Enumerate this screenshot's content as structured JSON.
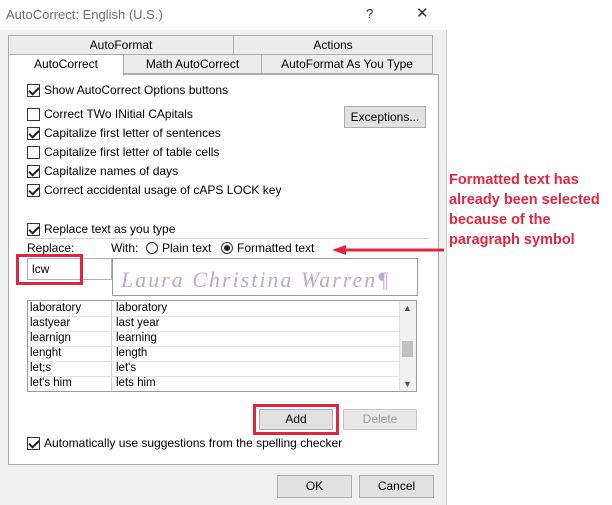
{
  "window": {
    "title": "AutoCorrect: English (U.S.)",
    "help": "?",
    "close": "✕"
  },
  "tabs": {
    "row1": [
      "AutoFormat",
      "Actions"
    ],
    "row2": [
      "AutoCorrect",
      "Math AutoCorrect",
      "AutoFormat As You Type"
    ]
  },
  "options": {
    "show_buttons": "Show AutoCorrect Options buttons",
    "two_initials": "Correct TWo INitial CApitals",
    "first_letter_sentences": "Capitalize first letter of sentences",
    "first_letter_cells": "Capitalize first letter of table cells",
    "names_of_days": "Capitalize names of days",
    "caps_lock": "Correct accidental usage of cAPS LOCK key",
    "exceptions_button": "Exceptions...",
    "replace_as_you_type": "Replace text as you type"
  },
  "replace": {
    "replace_label": "Replace:",
    "with_label": "With:",
    "plain_text": "Plain text",
    "formatted_text": "Formatted text",
    "selected_option": "Formatted text",
    "replace_value": "lcw",
    "with_value": "Laura Christina Warren¶"
  },
  "list": [
    [
      "laboratory",
      "laboratory"
    ],
    [
      "lastyear",
      "last year"
    ],
    [
      "learnign",
      "learning"
    ],
    [
      "lenght",
      "length"
    ],
    [
      "let;s",
      "let's"
    ],
    [
      "let's him",
      "lets him"
    ]
  ],
  "buttons": {
    "add": "Add",
    "delete": "Delete",
    "ok": "OK",
    "cancel": "Cancel"
  },
  "spelling_suggestions": "Automatically use suggestions from the spelling checker",
  "annotation": {
    "text": "Formatted text has already been selected because of the paragraph symbol",
    "color": "#e3263f"
  }
}
